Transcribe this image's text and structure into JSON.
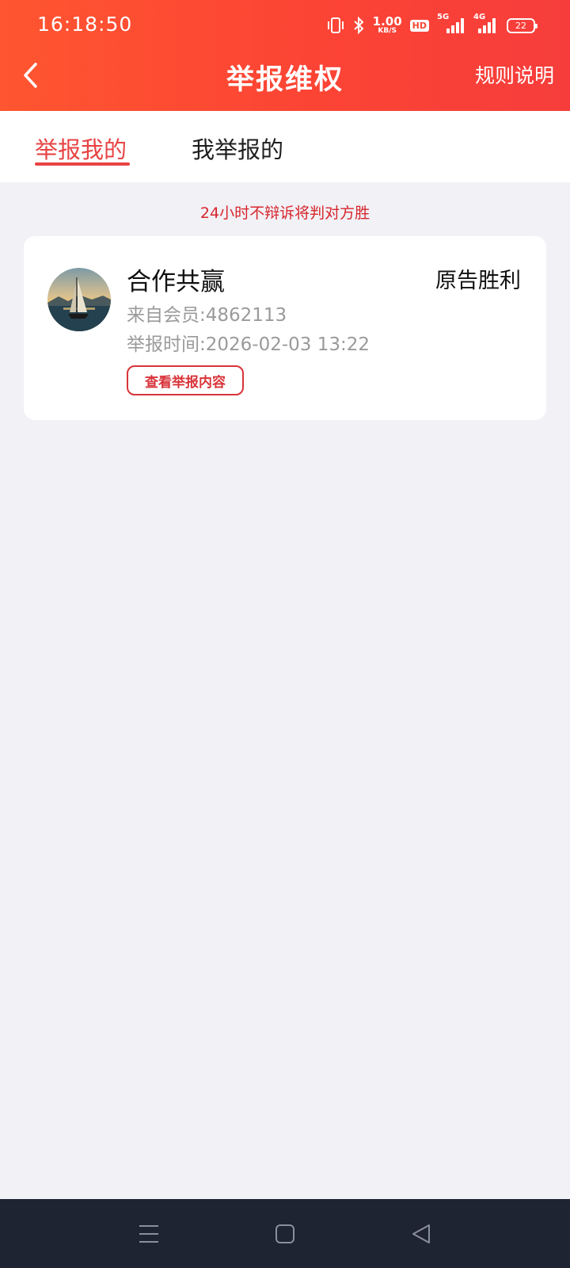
{
  "status_bar": {
    "time": "16:18:50",
    "net_speed_value": "1.00",
    "net_speed_unit": "KB/S",
    "hd_label": "HD",
    "network_5g": "5G",
    "network_4g": "4G",
    "battery": "22",
    "icons": [
      "vibrate-icon",
      "bluetooth-icon",
      "signal-5g-icon",
      "signal-4g-icon",
      "battery-icon"
    ]
  },
  "nav": {
    "title": "举报维权",
    "rules_label": "规则说明",
    "back_icon": "chevron-left-icon"
  },
  "tabs": [
    {
      "label": "举报我的",
      "active": true
    },
    {
      "label": "我举报的",
      "active": false
    }
  ],
  "notice": "24小时不辩诉将判对方胜",
  "reports": [
    {
      "name": "合作共赢",
      "result": "原告胜利",
      "member": "来自会员:4862113",
      "time": "举报时间:2026-02-03 13:22",
      "view_label": "查看举报内容"
    }
  ],
  "system_nav": {
    "icons": [
      "menu-icon",
      "home-icon",
      "back-triangle-icon"
    ]
  },
  "colors": {
    "header_start": "#ff5530",
    "header_end": "#f63d3b",
    "accent": "#e84343",
    "notice": "#d7262c",
    "background": "#f1f1f6",
    "system_nav": "#1f2432"
  }
}
